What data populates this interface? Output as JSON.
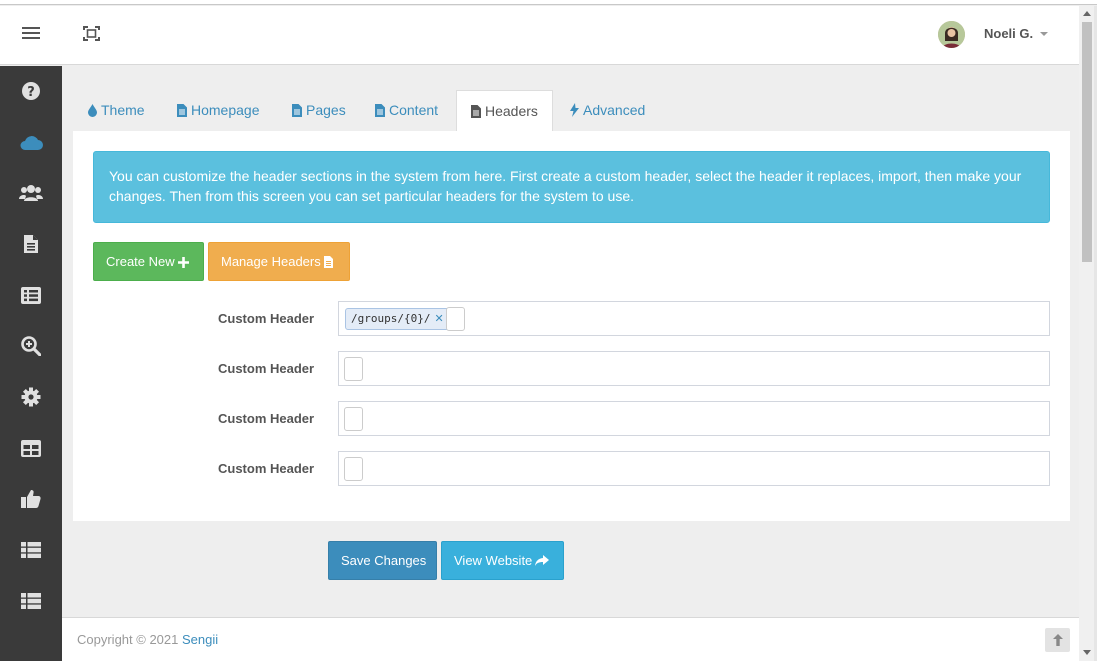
{
  "header": {
    "user_name": "Noeli G."
  },
  "sidebar": {
    "items": [
      {
        "icon": "question-icon"
      },
      {
        "icon": "cloud-icon",
        "active": true
      },
      {
        "icon": "users-icon"
      },
      {
        "icon": "file-icon"
      },
      {
        "icon": "list-icon"
      },
      {
        "icon": "search-plus-icon"
      },
      {
        "icon": "gear-icon"
      },
      {
        "icon": "table-icon"
      },
      {
        "icon": "thumbs-up-icon"
      },
      {
        "icon": "th-list-icon"
      },
      {
        "icon": "th-list-icon"
      }
    ]
  },
  "tabs": [
    {
      "label": "Theme",
      "icon": "tint-icon"
    },
    {
      "label": "Homepage",
      "icon": "file-text-icon"
    },
    {
      "label": "Pages",
      "icon": "file-text-icon"
    },
    {
      "label": "Content",
      "icon": "file-text-icon"
    },
    {
      "label": "Headers",
      "icon": "file-text-icon",
      "active": true
    },
    {
      "label": "Advanced",
      "icon": "bolt-icon"
    }
  ],
  "alert": {
    "text": "You can customize the header sections in the system from here. First create a custom header, select the header it replaces, import, then make your changes. Then from this screen you can set particular headers for the system to use."
  },
  "buttons": {
    "create_new": "Create New",
    "manage_headers": "Manage Headers",
    "save_changes": "Save Changes",
    "view_website": "View Website"
  },
  "fields": [
    {
      "label": "Custom Header",
      "tags": [
        "/groups/{0}/"
      ]
    },
    {
      "label": "Custom Header",
      "tags": []
    },
    {
      "label": "Custom Header",
      "tags": []
    },
    {
      "label": "Custom Header",
      "tags": []
    }
  ],
  "footer": {
    "copyright": "Copyright © 2021",
    "brand": "Sengii"
  },
  "colors": {
    "primary": "#3c8dbc",
    "success": "#5cb85c",
    "warning": "#f0ad4e",
    "info": "#5bc0de",
    "sidebar_bg": "#3a3a3a",
    "sidebar_active_icon": "#3c8dbc"
  }
}
